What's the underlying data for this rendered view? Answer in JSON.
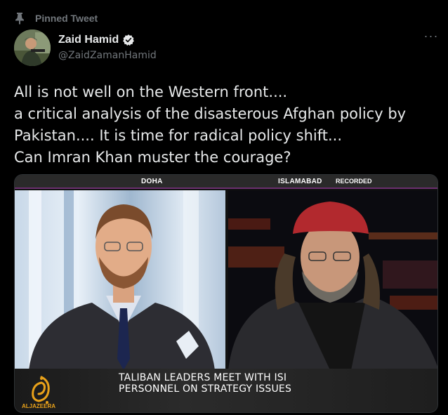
{
  "pinned": {
    "label": "Pinned Tweet",
    "icon": "pin-icon"
  },
  "author": {
    "name": "Zaid Hamid",
    "handle": "@ZaidZamanHamid",
    "verified_icon": "verified-badge-icon"
  },
  "more_label": "···",
  "tweet": {
    "lines": [
      "All is not well on the Western front....",
      "a critical analysis of the disasterous Afghan policy by",
      "Pakistan.... It is time for radical policy shift...",
      "Can Imran Khan muster the courage?"
    ]
  },
  "media": {
    "left_location": "DOHA",
    "right_location": "ISLAMABAD",
    "recorded_label": "RECORDED",
    "network_name": "ALJAZEERA",
    "headline_lines": [
      "TALIBAN LEADERS MEET WITH ISI",
      "PERSONNEL ON STRATEGY ISSUES"
    ]
  },
  "colors": {
    "background": "#000000",
    "text": "#e7e9ea",
    "secondary_text": "#71767b",
    "verified": "#e7e9ea",
    "strip_accent": "#6b2f6e",
    "aljazeera_gold": "#e8a11a"
  }
}
